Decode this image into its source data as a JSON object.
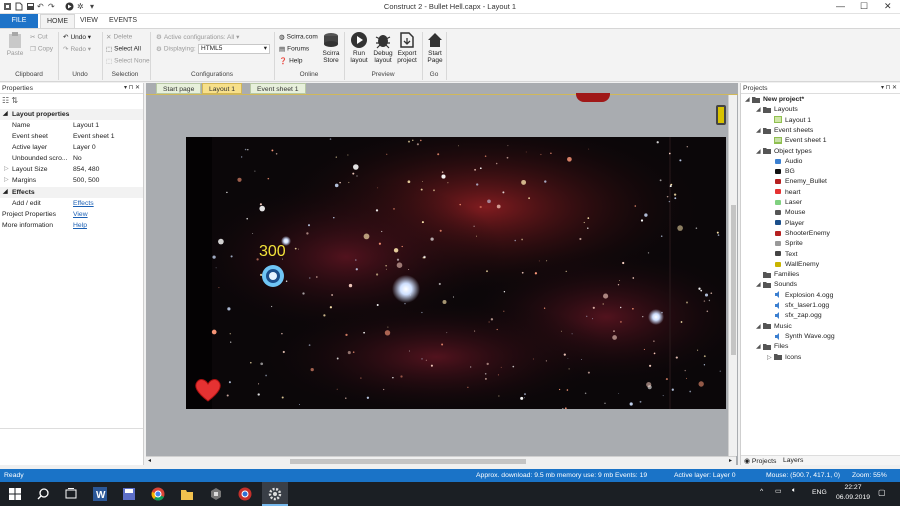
{
  "window": {
    "title": "Construct 2 - Bullet Hell.capx - Layout 1"
  },
  "menu": {
    "file": "FILE",
    "tabs": [
      "HOME",
      "VIEW",
      "EVENTS"
    ]
  },
  "ribbon": {
    "paste": "Paste",
    "cut": "Cut",
    "copy": "Copy",
    "undo": "Undo",
    "redo": "Redo",
    "delete": "Delete",
    "select_all": "Select All",
    "select_none": "Select None",
    "active_configs": "Active configurations: All",
    "displaying_label": "Displaying:",
    "displaying_value": "HTML5",
    "scirra_com": "Scirra.com",
    "forums": "Forums",
    "help": "Help",
    "scirra_store": [
      "Scirra",
      "Store"
    ],
    "run_layout": [
      "Run",
      "layout"
    ],
    "debug_layout": [
      "Debug",
      "layout"
    ],
    "export_project": [
      "Export",
      "project"
    ],
    "start_page": [
      "Start",
      "Page"
    ],
    "groups": [
      "Clipboard",
      "Undo",
      "Selection",
      "Configurations",
      "Online",
      "Preview",
      "Go"
    ]
  },
  "properties": {
    "header": "Properties",
    "section_layout": "Layout properties",
    "rows": [
      {
        "k": "Name",
        "v": "Layout 1"
      },
      {
        "k": "Event sheet",
        "v": "Event sheet 1"
      },
      {
        "k": "Active layer",
        "v": "Layer 0"
      },
      {
        "k": "Unbounded scro...",
        "v": "No"
      },
      {
        "k": "Layout Size",
        "v": "854, 480"
      },
      {
        "k": "Margins",
        "v": "500, 500"
      }
    ],
    "section_effects": "Effects",
    "add_edit": "Add / edit",
    "effects_link": "Effects",
    "project_props": "Project Properties",
    "view_link": "View",
    "more_info": "More information",
    "help_link": "Help"
  },
  "doc_tabs": [
    "Start page",
    "Layout 1",
    "Event sheet 1"
  ],
  "game": {
    "score": "300"
  },
  "projects": {
    "header": "Projects",
    "root": "New project*",
    "layouts": "Layouts",
    "layout1": "Layout 1",
    "event_sheets": "Event sheets",
    "event_sheet1": "Event sheet 1",
    "object_types": "Object types",
    "objects": [
      "Audio",
      "BG",
      "Enemy_Bullet",
      "heart",
      "Laser",
      "Mouse",
      "Player",
      "ShooterEnemy",
      "Sprite",
      "Text",
      "WallEnemy"
    ],
    "families": "Families",
    "sounds": "Sounds",
    "sound_files": [
      "Explosion 4.ogg",
      "sfx_laser1.ogg",
      "sfx_zap.ogg"
    ],
    "music": "Music",
    "music_files": [
      "Synth Wave.ogg"
    ],
    "files": "Files",
    "icons": "Icons",
    "bottom_tabs": [
      "Projects",
      "Layers"
    ]
  },
  "status": {
    "ready": "Ready",
    "approx": "Approx. download: 9.5 mb  memory use: 9 mb  Events: 19",
    "active_layer": "Active layer: Layer 0",
    "mouse": "Mouse: (500.7, 417.1, 0)",
    "zoom": "Zoom: 55%"
  },
  "taskbar": {
    "lang": "ENG",
    "time": "22:27",
    "date": "06.09.2019"
  },
  "colors": {
    "accent": "#1a73c7",
    "layout_tab": "#f7e08a",
    "score": "#f2e23a"
  }
}
